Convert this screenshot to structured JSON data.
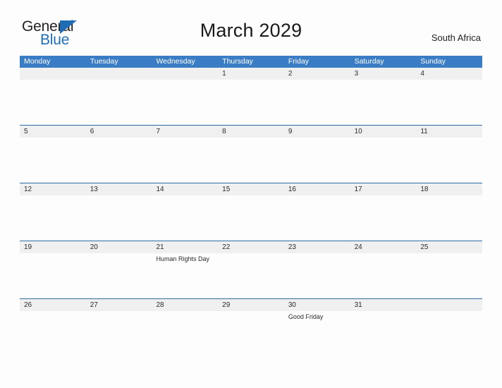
{
  "logo": {
    "text_primary": "General",
    "text_secondary": "Blue",
    "triangle_icon": "triangle-icon",
    "color_primary": "#231f20",
    "color_secondary": "#1f6eb5"
  },
  "header": {
    "title": "March 2029",
    "region": "South Africa"
  },
  "theme": {
    "header_blue": "#3b7dc4",
    "row_separator": "#2e6da4",
    "date_band_gray": "#f0f0f0",
    "page_background": "#fdfdfd"
  },
  "calendar": {
    "weekday_headers": [
      "Monday",
      "Tuesday",
      "Wednesday",
      "Thursday",
      "Friday",
      "Saturday",
      "Sunday"
    ],
    "weeks": [
      {
        "days": [
          {
            "date": "",
            "events": []
          },
          {
            "date": "",
            "events": []
          },
          {
            "date": "",
            "events": []
          },
          {
            "date": "1",
            "events": []
          },
          {
            "date": "2",
            "events": []
          },
          {
            "date": "3",
            "events": []
          },
          {
            "date": "4",
            "events": []
          }
        ]
      },
      {
        "days": [
          {
            "date": "5",
            "events": []
          },
          {
            "date": "6",
            "events": []
          },
          {
            "date": "7",
            "events": []
          },
          {
            "date": "8",
            "events": []
          },
          {
            "date": "9",
            "events": []
          },
          {
            "date": "10",
            "events": []
          },
          {
            "date": "11",
            "events": []
          }
        ]
      },
      {
        "days": [
          {
            "date": "12",
            "events": []
          },
          {
            "date": "13",
            "events": []
          },
          {
            "date": "14",
            "events": []
          },
          {
            "date": "15",
            "events": []
          },
          {
            "date": "16",
            "events": []
          },
          {
            "date": "17",
            "events": []
          },
          {
            "date": "18",
            "events": []
          }
        ]
      },
      {
        "days": [
          {
            "date": "19",
            "events": []
          },
          {
            "date": "20",
            "events": []
          },
          {
            "date": "21",
            "events": [
              "Human Rights Day"
            ]
          },
          {
            "date": "22",
            "events": []
          },
          {
            "date": "23",
            "events": []
          },
          {
            "date": "24",
            "events": []
          },
          {
            "date": "25",
            "events": []
          }
        ]
      },
      {
        "days": [
          {
            "date": "26",
            "events": []
          },
          {
            "date": "27",
            "events": []
          },
          {
            "date": "28",
            "events": []
          },
          {
            "date": "29",
            "events": []
          },
          {
            "date": "30",
            "events": [
              "Good Friday"
            ]
          },
          {
            "date": "31",
            "events": []
          },
          {
            "date": "",
            "events": []
          }
        ]
      }
    ]
  }
}
